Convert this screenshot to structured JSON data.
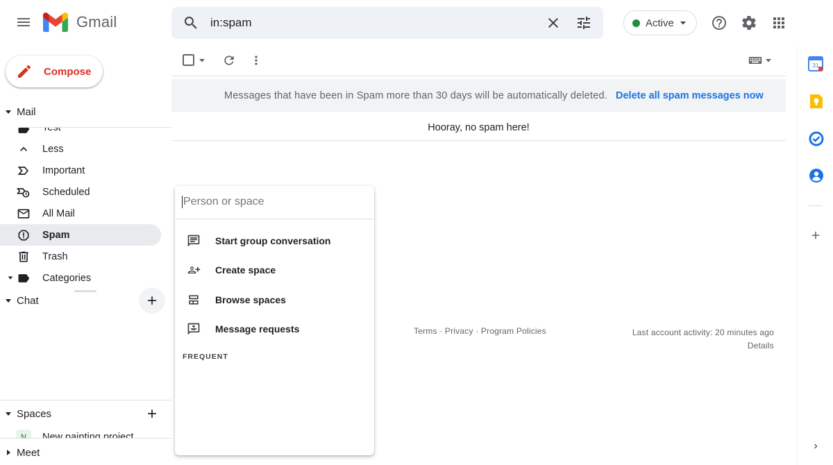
{
  "header": {
    "app_name": "Gmail",
    "search_value": "in:spam",
    "status_label": "Active",
    "icons": [
      "menu-icon",
      "search-icon",
      "clear-icon",
      "search-options-icon",
      "help-icon",
      "settings-icon",
      "apps-icon"
    ]
  },
  "sidebar": {
    "compose_label": "Compose",
    "mail_section": "Mail",
    "items": [
      {
        "label": "Test",
        "icon": "label-icon"
      },
      {
        "label": "Less",
        "icon": "chevron-up-icon"
      },
      {
        "label": "Important",
        "icon": "important-icon"
      },
      {
        "label": "Scheduled",
        "icon": "scheduled-icon"
      },
      {
        "label": "All Mail",
        "icon": "all-mail-icon"
      },
      {
        "label": "Spam",
        "icon": "spam-icon",
        "active": true
      },
      {
        "label": "Trash",
        "icon": "trash-icon"
      },
      {
        "label": "Categories",
        "icon": "label-icon"
      }
    ],
    "chat_section": "Chat",
    "spaces_section": "Spaces",
    "spaces": [
      {
        "label": "New painting project",
        "avatar": "N"
      }
    ],
    "meet_section": "Meet"
  },
  "main": {
    "banner_message": "Messages that have been in Spam more than 30 days will be automatically deleted.",
    "banner_action": "Delete all spam messages now",
    "empty_message": "Hooray, no spam here!",
    "footer": {
      "links": "Terms · Privacy · Program Policies",
      "activity": "Last account activity: 20 minutes ago",
      "details": "Details"
    }
  },
  "chat_popup": {
    "placeholder": "Person or space",
    "items": [
      {
        "label": "Start group conversation",
        "icon": "group-chat-icon"
      },
      {
        "label": "Create space",
        "icon": "create-space-icon"
      },
      {
        "label": "Browse spaces",
        "icon": "browse-spaces-icon"
      },
      {
        "label": "Message requests",
        "icon": "message-requests-icon"
      }
    ],
    "frequent_label": "FREQUENT"
  },
  "side_panel": {
    "apps": [
      "calendar-icon",
      "keep-icon",
      "tasks-icon",
      "contacts-icon"
    ],
    "calendar_date": "31"
  },
  "colors": {
    "accent": "#1a73e8",
    "compose_text": "#d93025",
    "status_dot": "#1e8e3e",
    "active_bg": "#e8eaed"
  }
}
